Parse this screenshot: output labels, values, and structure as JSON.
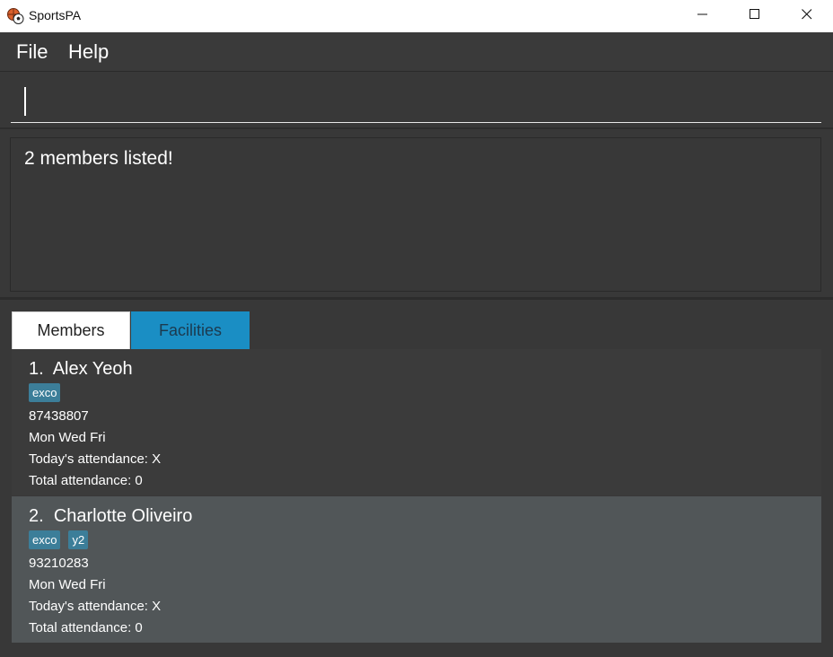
{
  "window": {
    "title": "SportsPA",
    "app_icon": "sports-balls-icon",
    "controls": [
      "minimize-icon",
      "maximize-icon",
      "close-icon"
    ]
  },
  "menu": {
    "file": "File",
    "help": "Help"
  },
  "command": {
    "value": ""
  },
  "result": {
    "message": "2 members listed!"
  },
  "tabs": {
    "members": "Members",
    "facilities": "Facilities",
    "active": "Members"
  },
  "members": [
    {
      "index": "1.",
      "name": "Alex Yeoh",
      "tags": [
        "exco"
      ],
      "phone": "87438807",
      "days": "Mon Wed Fri",
      "today_attendance": "Today's attendance: X",
      "total_attendance": "Total attendance: 0"
    },
    {
      "index": "2.",
      "name": "Charlotte Oliveiro",
      "tags": [
        "exco",
        "y2"
      ],
      "phone": "93210283",
      "days": "Mon Wed Fri",
      "today_attendance": "Today's attendance: X",
      "total_attendance": "Total attendance: 0"
    }
  ],
  "colors": {
    "background": "#383838",
    "tab_active": "#ffffff",
    "tab_inactive": "#1a8ec4",
    "tag": "#3c7e99",
    "selected_row": "#515658"
  }
}
